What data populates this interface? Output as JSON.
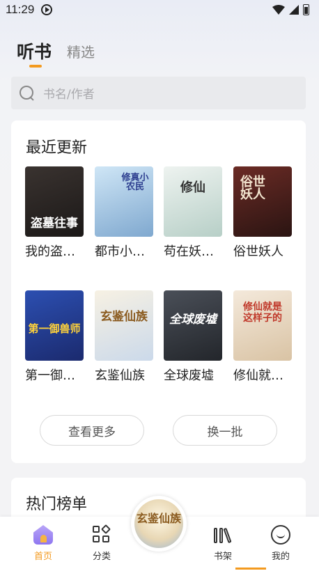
{
  "status_bar": {
    "time": "11:29"
  },
  "tabs": {
    "active": "听书",
    "other": "精选"
  },
  "search": {
    "placeholder": "书名/作者"
  },
  "recent": {
    "title": "最近更新",
    "books": [
      {
        "title": "我的盗…",
        "cover_text": "盗墓往事",
        "colors": [
          "#3a3330",
          "#1b1817"
        ],
        "text_color": "#ffffff"
      },
      {
        "title": "都市小…",
        "cover_text": "修真小农民",
        "colors": [
          "#cfe6f6",
          "#7fa8cf"
        ],
        "text_color": "#2d3e8f"
      },
      {
        "title": "苟在妖…",
        "cover_text": "修仙",
        "colors": [
          "#eef3f0",
          "#b7cfc7"
        ],
        "text_color": "#333333"
      },
      {
        "title": "俗世妖人",
        "cover_text": "俗世妖人",
        "colors": [
          "#6b2b25",
          "#2a1412"
        ],
        "text_color": "#f3e6d0"
      },
      {
        "title": "第一御…",
        "cover_text": "第一御兽师",
        "colors": [
          "#2c4fb1",
          "#1b2a6e"
        ],
        "text_color": "#ffd23a"
      },
      {
        "title": "玄鉴仙族",
        "cover_text": "玄鉴仙族",
        "colors": [
          "#f7f1e3",
          "#cbd9ea"
        ],
        "text_color": "#8a5a1e"
      },
      {
        "title": "全球废墟",
        "cover_text": "全球废墟",
        "colors": [
          "#4a4f58",
          "#23262b"
        ],
        "text_color": "#ffffff"
      },
      {
        "title": "修仙就…",
        "cover_text": "修仙就是这样子的",
        "colors": [
          "#f4e9db",
          "#d9c3a4"
        ],
        "text_color": "#c0392b"
      }
    ],
    "more_button": "查看更多",
    "refresh_button": "换一批"
  },
  "hot": {
    "title": "热门榜单"
  },
  "nav": {
    "home": "首页",
    "category": "分类",
    "shelf": "书架",
    "mine": "我的"
  },
  "player": {
    "cover_text": "玄鉴仙族"
  },
  "accent_color": "#f39a1f"
}
